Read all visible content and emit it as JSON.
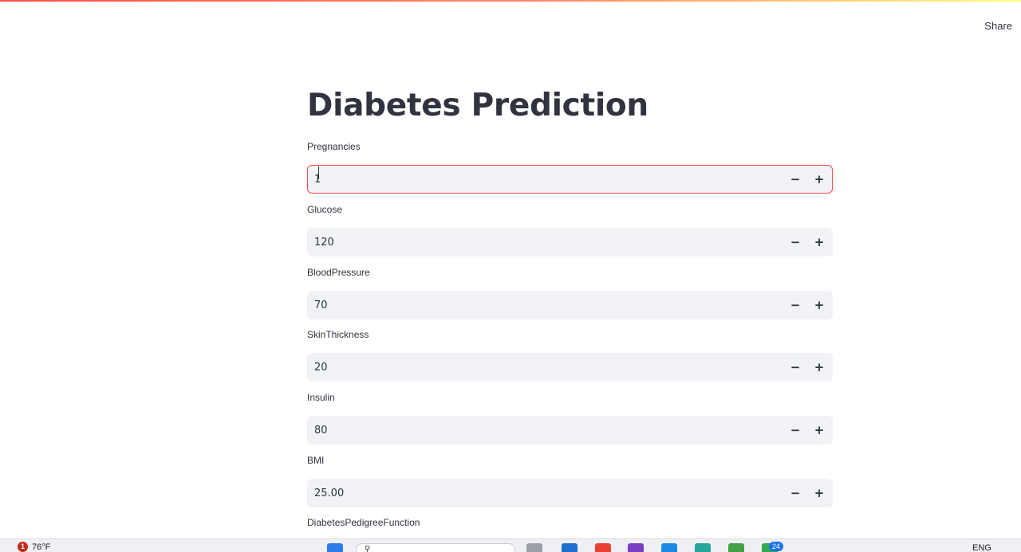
{
  "header": {
    "share_label": "Share"
  },
  "page": {
    "title": "Diabetes Prediction"
  },
  "fields": [
    {
      "label": "Pregnancies",
      "value": "1"
    },
    {
      "label": "Glucose",
      "value": "120"
    },
    {
      "label": "BloodPressure",
      "value": "70"
    },
    {
      "label": "SkinThickness",
      "value": "20"
    },
    {
      "label": "Insulin",
      "value": "80"
    },
    {
      "label": "BMI",
      "value": "25.00"
    },
    {
      "label": "DiabetesPedigreeFunction",
      "value": ""
    }
  ],
  "stepper": {
    "minus_symbol": "−",
    "plus_symbol": "+"
  },
  "taskbar": {
    "weather_badge": "1",
    "temperature": "76°F",
    "language": "ENG",
    "notification_count": "24"
  },
  "colors": {
    "accent": "#ff4b4b",
    "input_bg": "#f0f2f6",
    "text": "#31333f"
  }
}
